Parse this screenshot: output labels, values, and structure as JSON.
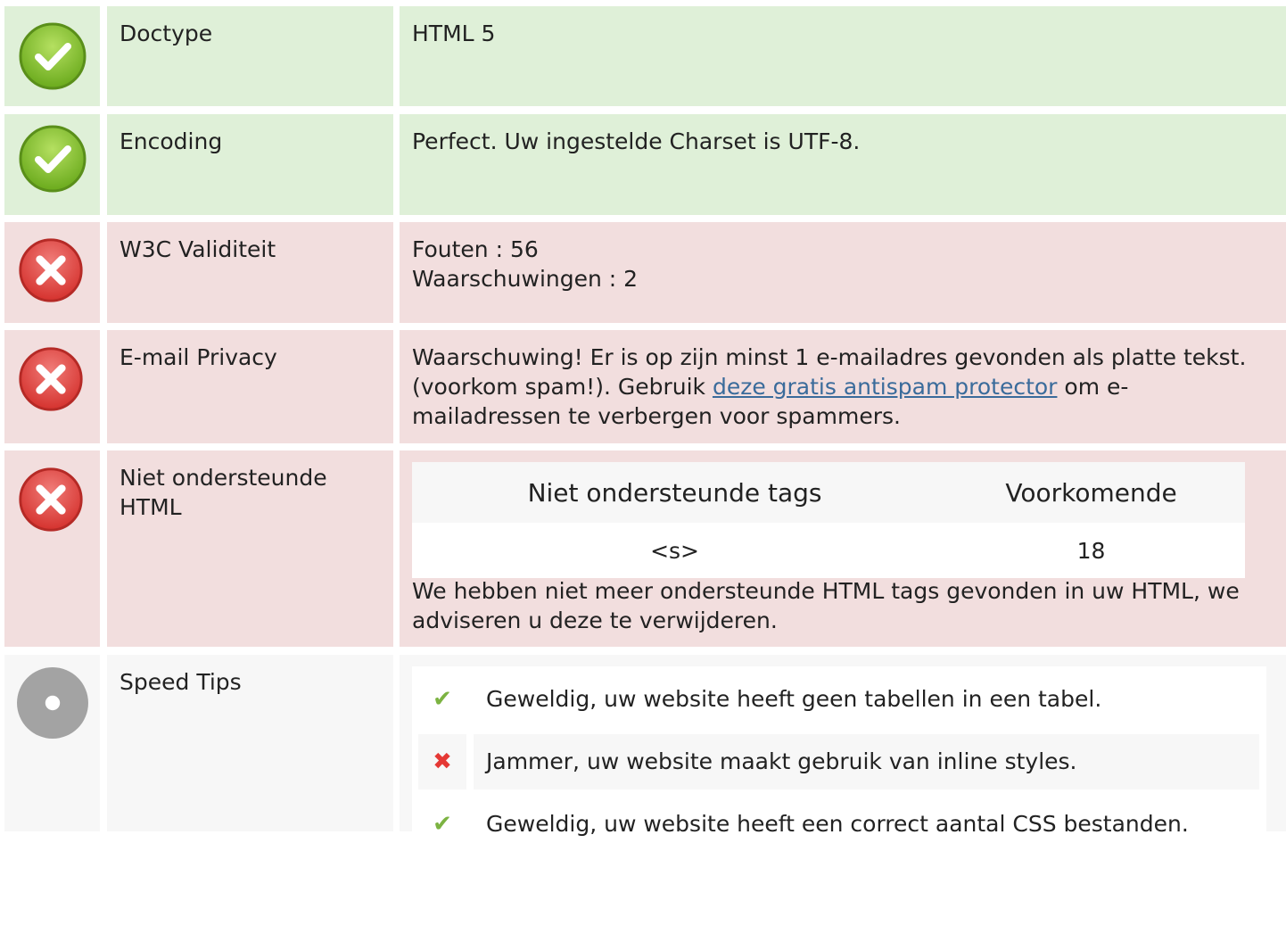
{
  "rows": [
    {
      "status": "pass",
      "label": "Doctype",
      "value": "HTML 5"
    },
    {
      "status": "pass",
      "label": "Encoding",
      "value": "Perfect. Uw ingestelde Charset is UTF-8."
    },
    {
      "status": "fail",
      "label": "W3C Validiteit",
      "value_lines": [
        "Fouten : 56",
        "Waarschuwingen : 2"
      ]
    },
    {
      "status": "fail",
      "label": "E-mail Privacy",
      "value_before": "Waarschuwing! Er is op zijn minst 1 e-mailadres gevonden als platte tekst. (voorkom spam!). Gebruik ",
      "link_text": "deze gratis antispam protector",
      "value_after": " om e-mailadressen te verbergen voor spammers."
    },
    {
      "status": "fail",
      "label": "Niet ondersteunde HTML",
      "table": {
        "headers": [
          "Niet ondersteunde tags",
          "Voorkomende"
        ],
        "rows": [
          [
            "<s>",
            "18"
          ]
        ]
      },
      "note": "We hebben niet meer ondersteunde HTML tags gevonden in uw HTML, we adviseren u deze te verwijderen."
    },
    {
      "status": "info",
      "label": "Speed Tips",
      "tips": [
        {
          "ok": true,
          "text": "Geweldig, uw website heeft geen tabellen in een tabel."
        },
        {
          "ok": false,
          "text": "Jammer, uw website maakt gebruik van inline styles."
        },
        {
          "ok": true,
          "text": "Geweldig, uw website heeft een correct aantal CSS bestanden."
        }
      ]
    }
  ],
  "icons": {
    "pass": "check-circle-icon",
    "fail": "x-circle-icon",
    "info": "gray-dot-circle-icon",
    "tip_ok": "checkmark-icon",
    "tip_bad": "x-mark-icon"
  },
  "colors": {
    "pass_bg": "#dff0d8",
    "fail_bg": "#f2dede",
    "info_bg": "#f7f7f7",
    "link": "#3a6b9b"
  }
}
